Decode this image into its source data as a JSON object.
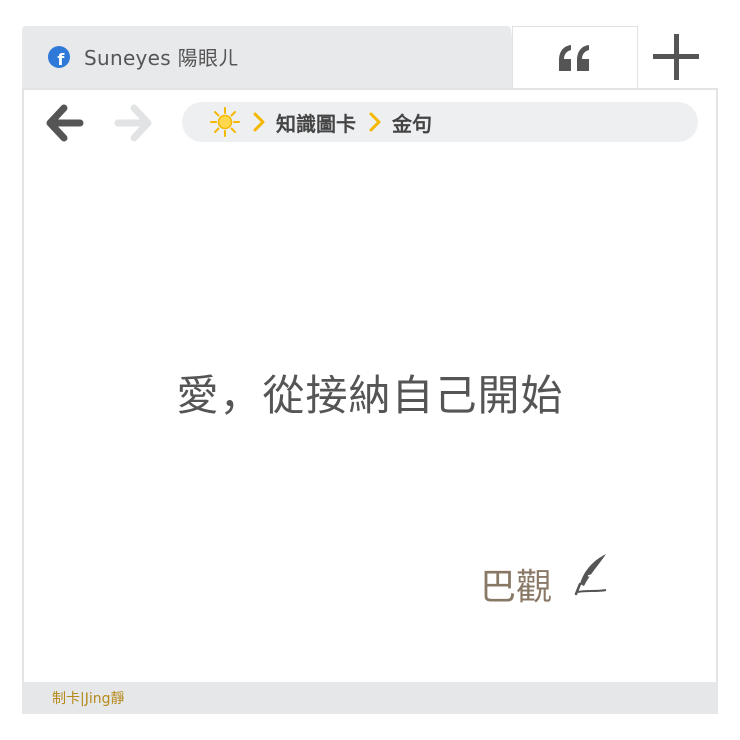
{
  "tab": {
    "title": "Suneyes 陽眼ㄦ"
  },
  "breadcrumb": {
    "items": [
      "知識圖卡",
      "金句"
    ]
  },
  "content": {
    "quote": "愛，從接納自己開始",
    "author": "巴觀"
  },
  "footer": {
    "credit": "制卡|Jing靜"
  },
  "colors": {
    "accent": "#f5b800",
    "facebook": "#2f79d8",
    "footer_text": "#b58a1c"
  },
  "icons": [
    "facebook-icon",
    "quote-icon",
    "plus-icon",
    "back-arrow-icon",
    "forward-arrow-icon",
    "sun-icon",
    "chevron-right-icon",
    "quill-icon"
  ]
}
